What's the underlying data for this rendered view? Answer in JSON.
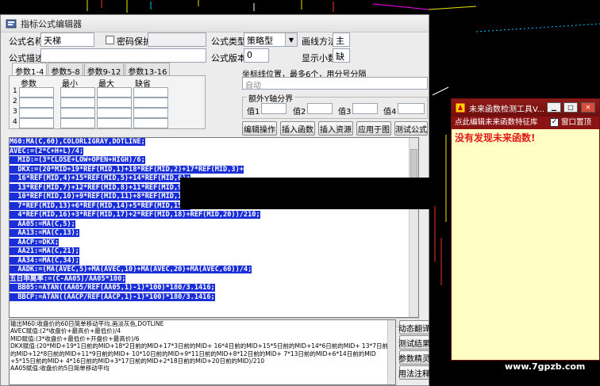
{
  "editor": {
    "title": "指标公式编辑器",
    "name_label": "公式名称",
    "name_value": "天梯",
    "password_label": "密码保护",
    "desc_label": "公式描述",
    "type_label": "公式类型",
    "type_value": "策略型",
    "draw_label": "画线方法",
    "draw_value": "主",
    "version_label": "公式版本",
    "version_value": "0",
    "decimal_label": "显示小数",
    "decimal_value": "缺",
    "tabs": [
      "参数1-4",
      "参数5-8",
      "参数9-12",
      "参数13-16"
    ],
    "param_headers": [
      "参数",
      "最小",
      "最大",
      "缺省"
    ],
    "param_rows": [
      "1",
      "2",
      "3",
      "4"
    ],
    "axis_label": "坐标线位置，最多6个，用分号分隔",
    "axis_value": "自动",
    "extra_axis_title": "额外Y轴分界",
    "extra_values": [
      "值1",
      "值2",
      "值3",
      "值4"
    ],
    "buttons": [
      "编辑操作",
      "插入函数",
      "插入资源",
      "应用于图",
      "测试公式"
    ],
    "side_buttons": [
      "动态翻译",
      "测试结果",
      "参数精灵",
      "用法注释"
    ]
  },
  "code_lines": [
    "M60:MA(C,60),COLORLIGRAY,DOTLINE;",
    "AVEC:=(2*C+H+L)/4;",
    "  MID:=(3*CLOSE+LOW+OPEN+HIGH)/6;",
    "  DKX:=(20*MID+19*REF(MID,1)+18*REF(MID,2)+17*REF(MID,3)+",
    "  16*REF(MID,4)+15*REF(MID,5)+14*REF(MID,6)+",
    "  13*REF(MID,7)+12*REF(MID,8)+11*REF(MID,9)+",
    "  10*REF(MID,10)+9*REF(MID,11)+8*REF(MID,12)+",
    "  7*REF(MID,13)+6*REF(MID,14)+5*REF(MID,15)+",
    "  4*REF(MID,16)+3*REF(MID,17)+2*REF(MID,18)+REF(MID,20))/210;",
    "  AA05:=MA(C,5);",
    "  AA13:=MA(C,13);",
    "  AACP:=DKX;",
    "  AA21:=MA(C,21);",
    "  AA34:=MA(C,34);",
    "  AADK:=(MA(AVEC,5)+MA(AVEC,10)+MA(AVEC,20)+MA(AVEC,60))/4;",
    "五日乖离率:=(C-AA05)/AA05*100;",
    "  BB05:=ATAN((AA05/REF(AA05,1)-1)*100)*180/3.1416;",
    "  BBCP:=ATAN((AACP/REF(AACP,1)-1)*100)*180/3.1416;"
  ],
  "explain_lines": [
    "输出M60:收盘价的60日简单移动平均,画淡灰色,DOTLINE",
    "AVEC赋值:(2*收盘价+最高价+最低价)/4",
    "MID赋值:(3*收盘价+最低价+开盘价+最高价)/6",
    "DKX赋值:(20*MID+19*1日前的MID+18*2日前的MID+17*3日前的MID+ 16*4日前的MID+15*5日前的MID+14*6日前的MID+ 13*7日前",
    "的MID+12*8日前的MID+11*9日前的MID+ 10*10日前的MID+9*11日前的MID+8*12日前的MID+ 7*13日前的MID+6*14日前的MID",
    "+5*15日前的MID+ 4*16日前的MID+3*17日前的MID+2*18日前的MID+20日前的MID)/210",
    "AA05赋值:收盘价的5日简单移动平均"
  ],
  "checker": {
    "title": "未来函数检测工具V...",
    "bar_text": "点此编辑未来函数特征库",
    "ontop_label": "窗口置顶",
    "message": "没有发现未来函数!"
  },
  "watermark": "www.7gpzb.com",
  "colors": {
    "selection": "#1a2fd8",
    "checker_bg": "#ffffc4",
    "checker_title": "#8e1a18",
    "alert_text": "#e21a1a"
  }
}
